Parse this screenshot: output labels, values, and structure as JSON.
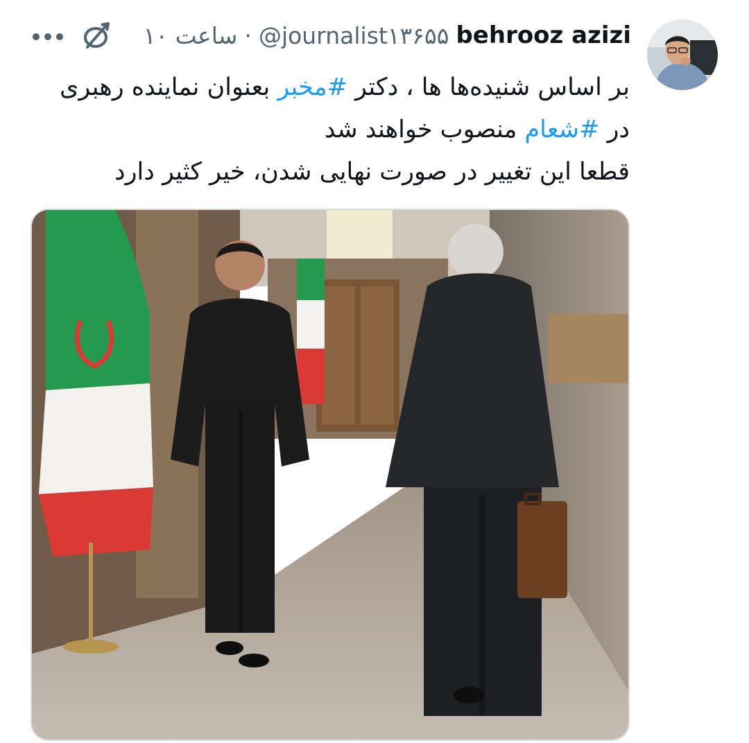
{
  "tweet": {
    "display_name": "behrooz azizi",
    "handle": "@journalist۱۳۶۵۵",
    "separator": "·",
    "time": "۱۰ ساعت",
    "text_lines": [
      {
        "parts": [
          {
            "text": "بر اساس شنیده‌ها ها ، دکتر ",
            "hashtag": false
          },
          {
            "text": "#مخبر",
            "hashtag": true
          },
          {
            "text": " بعنوان نماینده رهبری",
            "hashtag": false
          }
        ]
      },
      {
        "parts": [
          {
            "text": "در ",
            "hashtag": false
          },
          {
            "text": "#شعام",
            "hashtag": true
          },
          {
            "text": " منصوب خواهند شد",
            "hashtag": false
          }
        ]
      },
      {
        "parts": [
          {
            "text": "قطعا این تغییر در صورت نهایی شدن، خیر کثیر دارد",
            "hashtag": false
          }
        ]
      }
    ],
    "hashtag_color": "#1d9bf0"
  },
  "icons": {
    "avatar": "user-avatar",
    "app": "bird-icon",
    "more": "more-icon"
  },
  "media": {
    "kind": "photo",
    "scene": "corridor-two-men-iran-flags"
  }
}
